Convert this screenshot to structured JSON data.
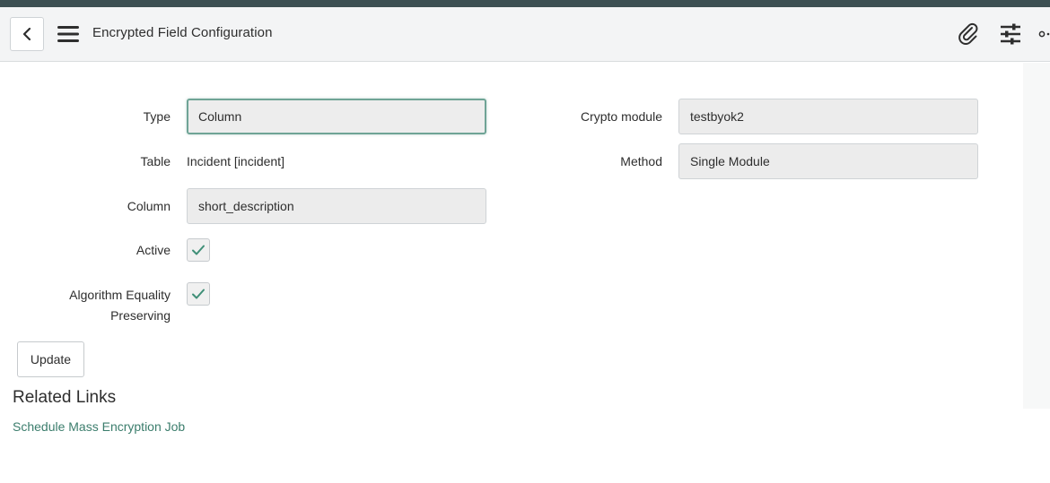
{
  "header": {
    "title": "Encrypted Field Configuration",
    "icons": [
      "back-icon",
      "hamburger-menu-icon",
      "paperclip-icon",
      "settings-sliders-icon",
      "more-options-icon"
    ]
  },
  "form": {
    "type": {
      "label": "Type",
      "value": "Column"
    },
    "table": {
      "label": "Table",
      "value": "Incident [incident]"
    },
    "column": {
      "label": "Column",
      "value": "short_description"
    },
    "active": {
      "label": "Active",
      "checked": true
    },
    "algorithm": {
      "label_line1": "Algorithm Equality",
      "label_line2": "Preserving",
      "checked": true
    },
    "crypto_module": {
      "label": "Crypto module",
      "value": "testbyok2"
    },
    "method": {
      "label": "Method",
      "value": "Single Module"
    }
  },
  "actions": {
    "update_label": "Update"
  },
  "related_links": {
    "title": "Related Links",
    "items": [
      "Schedule Mass Encryption Job"
    ]
  },
  "colors": {
    "accent": "#6fa496",
    "link": "#3b7d6c",
    "header_bg": "#f3f4f5",
    "top_strip": "#3c4f52",
    "check": "#3f8f77"
  }
}
